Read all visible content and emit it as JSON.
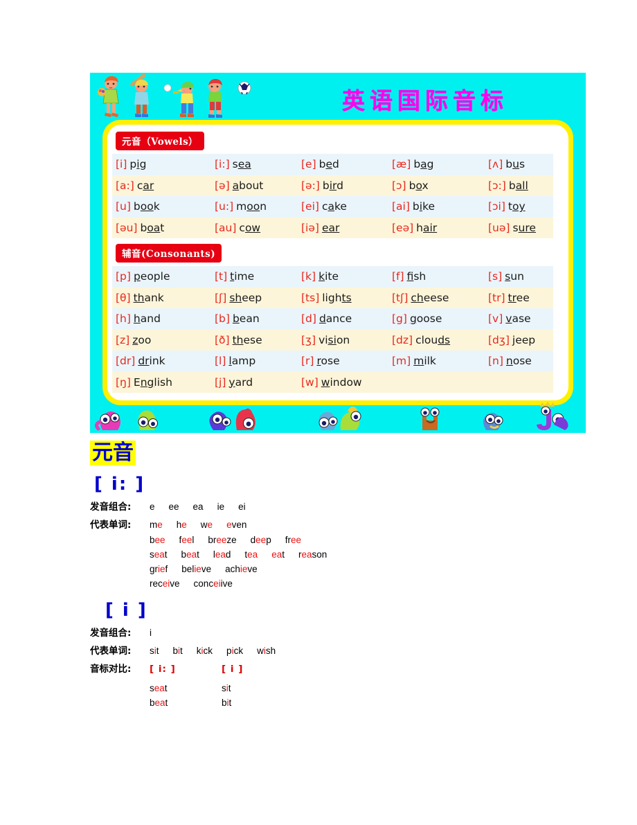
{
  "poster": {
    "title": "英语国际音标",
    "bg_color": "#00F0F0",
    "title_color": "#FF00EA",
    "frame_color": "#FFEF00",
    "vowels_label_cn": "元音",
    "vowels_label_en": "（Vowels）",
    "consonants_label_cn": "辅音",
    "consonants_label_en": "(Consonants)",
    "label_bg_color": "#E60012",
    "row_colors": [
      "#EAF5FB",
      "#FDF5D9"
    ],
    "phonetic_color": "#E8281E",
    "vowel_rows": [
      [
        {
          "ph": "[i]",
          "pre": "p",
          "mark": "i",
          "post": "g"
        },
        {
          "ph": "[i:]",
          "pre": "s",
          "mark": "ea",
          "post": ""
        },
        {
          "ph": "[e]",
          "pre": "b",
          "mark": "e",
          "post": "d"
        },
        {
          "ph": "[æ]",
          "pre": "b",
          "mark": "a",
          "post": "g"
        },
        {
          "ph": "[ʌ]",
          "pre": "b",
          "mark": "u",
          "post": "s"
        }
      ],
      [
        {
          "ph": "[a:]",
          "pre": "c",
          "mark": "ar",
          "post": ""
        },
        {
          "ph": "[ə]",
          "pre": "",
          "mark": "a",
          "post": "bout"
        },
        {
          "ph": "[ə:]",
          "pre": "b",
          "mark": "ir",
          "post": "d"
        },
        {
          "ph": "[ɔ]",
          "pre": "b",
          "mark": "o",
          "post": "x"
        },
        {
          "ph": "[ɔ:]",
          "pre": "b",
          "mark": "all",
          "post": ""
        }
      ],
      [
        {
          "ph": "[u]",
          "pre": "b",
          "mark": "oo",
          "post": "k"
        },
        {
          "ph": "[u:]",
          "pre": "m",
          "mark": "oo",
          "post": "n"
        },
        {
          "ph": "[ei]",
          "pre": "c",
          "mark": "a",
          "post": "ke"
        },
        {
          "ph": "[ai]",
          "pre": "b",
          "mark": "i",
          "post": "ke"
        },
        {
          "ph": "[ɔi]",
          "pre": "t",
          "mark": "oy",
          "post": ""
        }
      ],
      [
        {
          "ph": "[əu]",
          "pre": "b",
          "mark": "oa",
          "post": "t"
        },
        {
          "ph": "[au]",
          "pre": "c",
          "mark": "ow",
          "post": ""
        },
        {
          "ph": "[iə]",
          "pre": "",
          "mark": "ear",
          "post": ""
        },
        {
          "ph": "[eə]",
          "pre": "h",
          "mark": "air",
          "post": ""
        },
        {
          "ph": "[uə]",
          "pre": "s",
          "mark": "ure",
          "post": ""
        }
      ]
    ],
    "consonant_rows": [
      [
        {
          "ph": "[p]",
          "pre": "",
          "mark": "p",
          "post": "eople"
        },
        {
          "ph": "[t]",
          "pre": "",
          "mark": "t",
          "post": "ime"
        },
        {
          "ph": "[k]",
          "pre": "",
          "mark": "k",
          "post": "ite"
        },
        {
          "ph": "[f]",
          "pre": "",
          "mark": "f",
          "post": "ish"
        },
        {
          "ph": "[s]",
          "pre": "",
          "mark": "s",
          "post": "un"
        }
      ],
      [
        {
          "ph": "[θ]",
          "pre": "",
          "mark": "th",
          "post": "ank"
        },
        {
          "ph": "[ʃ]",
          "pre": "",
          "mark": "sh",
          "post": "eep"
        },
        {
          "ph": "[ts]",
          "pre": "ligh",
          "mark": "ts",
          "post": ""
        },
        {
          "ph": "[tʃ]",
          "pre": "",
          "mark": "ch",
          "post": "eese"
        },
        {
          "ph": "[tr]",
          "pre": "",
          "mark": "tr",
          "post": "ee"
        }
      ],
      [
        {
          "ph": "[h]",
          "pre": "",
          "mark": "h",
          "post": "and"
        },
        {
          "ph": "[b]",
          "pre": "",
          "mark": "b",
          "post": "ean"
        },
        {
          "ph": "[d]",
          "pre": "",
          "mark": "d",
          "post": "ance"
        },
        {
          "ph": "[g]",
          "pre": "",
          "mark": "g",
          "post": "oose"
        },
        {
          "ph": "[v]",
          "pre": "",
          "mark": "v",
          "post": "ase"
        }
      ],
      [
        {
          "ph": "[z]",
          "pre": "",
          "mark": "z",
          "post": "oo"
        },
        {
          "ph": "[ð]",
          "pre": "",
          "mark": "th",
          "post": "ese"
        },
        {
          "ph": "[ʒ]",
          "pre": "vi",
          "mark": "si",
          "post": "on"
        },
        {
          "ph": "[dz]",
          "pre": "clou",
          "mark": "ds",
          "post": ""
        },
        {
          "ph": "[dʒ]",
          "pre": "",
          "mark": "j",
          "post": "eep"
        }
      ],
      [
        {
          "ph": "[dr]",
          "pre": "",
          "mark": "dr",
          "post": "ink"
        },
        {
          "ph": "[l]",
          "pre": "",
          "mark": "l",
          "post": "amp"
        },
        {
          "ph": "[r]",
          "pre": "",
          "mark": "r",
          "post": "ose"
        },
        {
          "ph": "[m]",
          "pre": "",
          "mark": "m",
          "post": "ilk"
        },
        {
          "ph": "[n]",
          "pre": "",
          "mark": "n",
          "post": "ose"
        }
      ],
      [
        {
          "ph": "[ŋ]",
          "pre": "E",
          "mark": "ng",
          "post": "lish"
        },
        {
          "ph": "[j]",
          "pre": "",
          "mark": "y",
          "post": "ard"
        },
        {
          "ph": "[w]",
          "pre": "",
          "mark": "w",
          "post": "indow"
        },
        {
          "ph": "",
          "pre": "",
          "mark": "",
          "post": ""
        },
        {
          "ph": "",
          "pre": "",
          "mark": "",
          "post": ""
        }
      ]
    ]
  },
  "sheet": {
    "section_title": "元音",
    "section_title_bg": "#FFFF00",
    "section_title_color": "#0000CC",
    "highlight_color": "#EE1111",
    "labels": {
      "combination": "发音组合:",
      "words": "代表单词:",
      "compare": "音标对比:"
    },
    "entries": [
      {
        "symbol": "[ i: ]",
        "combinations": [
          "e",
          "ee",
          "ea",
          "ie",
          "ei"
        ],
        "word_lines": [
          [
            {
              "pre": "m",
              "mark": "e",
              "post": ""
            },
            {
              "pre": "h",
              "mark": "e",
              "post": ""
            },
            {
              "pre": "w",
              "mark": "e",
              "post": ""
            },
            {
              "pre": "",
              "mark": "e",
              "post": "ven"
            }
          ],
          [
            {
              "pre": "b",
              "mark": "ee",
              "post": ""
            },
            {
              "pre": "f",
              "mark": "ee",
              "post": "l"
            },
            {
              "pre": "br",
              "mark": "ee",
              "post": "ze"
            },
            {
              "pre": "d",
              "mark": "ee",
              "post": "p"
            },
            {
              "pre": "fr",
              "mark": "ee",
              "post": ""
            }
          ],
          [
            {
              "pre": "s",
              "mark": "ea",
              "post": "t"
            },
            {
              "pre": "b",
              "mark": "ea",
              "post": "t"
            },
            {
              "pre": "l",
              "mark": "ea",
              "post": "d"
            },
            {
              "pre": "t",
              "mark": "ea",
              "post": ""
            },
            {
              "pre": "",
              "mark": "ea",
              "post": "t"
            },
            {
              "pre": "r",
              "mark": "ea",
              "post": "son"
            }
          ],
          [
            {
              "pre": "gr",
              "mark": "ie",
              "post": "f"
            },
            {
              "pre": "bel",
              "mark": "ie",
              "post": "ve"
            },
            {
              "pre": "ach",
              "mark": "ie",
              "post": "ve"
            }
          ],
          [
            {
              "pre": "rec",
              "mark": "ei",
              "post": "ve"
            },
            {
              "pre": "conc",
              "mark": "ei",
              "post": "ive"
            }
          ]
        ]
      },
      {
        "symbol": "[ i ]",
        "combinations": [
          "i"
        ],
        "word_lines": [
          [
            {
              "pre": "s",
              "mark": "i",
              "post": "t"
            },
            {
              "pre": "b",
              "mark": "i",
              "post": "t"
            },
            {
              "pre": "k",
              "mark": "i",
              "post": "ck"
            },
            {
              "pre": "p",
              "mark": "i",
              "post": "ck"
            },
            {
              "pre": "w",
              "mark": "i",
              "post": "sh"
            }
          ]
        ],
        "comparison": {
          "head_left": "[ i: ]",
          "head_right": "[ i ]",
          "pairs": [
            {
              "left": {
                "pre": "s",
                "mark": "ea",
                "post": "t"
              },
              "right": {
                "pre": "s",
                "mark": "i",
                "post": "t"
              }
            },
            {
              "left": {
                "pre": "b",
                "mark": "ea",
                "post": "t"
              },
              "right": {
                "pre": "b",
                "mark": "i",
                "post": "t"
              }
            }
          ]
        }
      }
    ]
  }
}
